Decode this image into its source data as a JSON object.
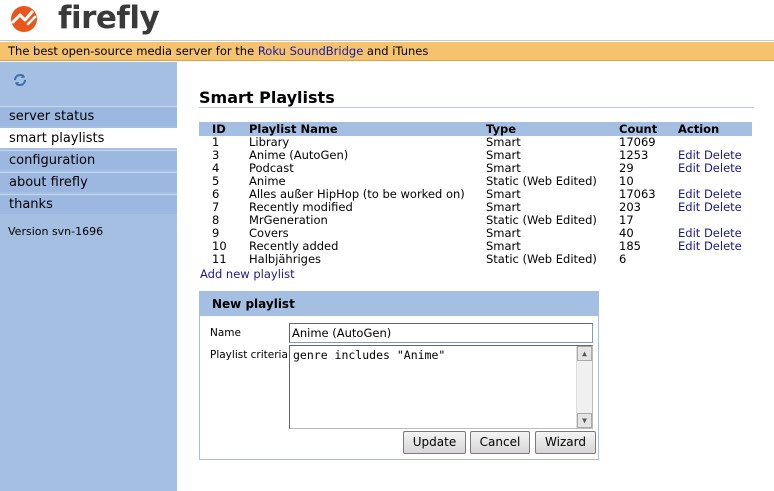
{
  "brand": {
    "name": "firefly",
    "accent": "#e8561c"
  },
  "tagline": {
    "prefix": "The best open-source media server for the ",
    "link": "Roku SoundBridge",
    "suffix": " and iTunes"
  },
  "sidebar": {
    "refresh_icon": "refresh-icon",
    "items": [
      {
        "label": "server status"
      },
      {
        "label": "smart playlists"
      },
      {
        "label": "configuration"
      },
      {
        "label": "about firefly"
      },
      {
        "label": "thanks"
      }
    ],
    "version": "Version svn-1696"
  },
  "main": {
    "title": "Smart Playlists",
    "columns": [
      "ID",
      "Playlist Name",
      "Type",
      "Count",
      "Action"
    ],
    "rows": [
      {
        "id": "1",
        "name": "Library",
        "type": "Smart",
        "count": "17069",
        "edit": "",
        "delete": ""
      },
      {
        "id": "3",
        "name": "Anime (AutoGen)",
        "type": "Smart",
        "count": "1253",
        "edit": "Edit",
        "delete": "Delete"
      },
      {
        "id": "4",
        "name": "Podcast",
        "type": "Smart",
        "count": "29",
        "edit": "Edit",
        "delete": "Delete"
      },
      {
        "id": "5",
        "name": "Anime",
        "type": "Static (Web Edited)",
        "count": "10",
        "edit": "",
        "delete": ""
      },
      {
        "id": "6",
        "name": "Alles außer HipHop (to be worked on)",
        "type": "Smart",
        "count": "17063",
        "edit": "Edit",
        "delete": "Delete"
      },
      {
        "id": "7",
        "name": "Recently modified",
        "type": "Smart",
        "count": "203",
        "edit": "Edit",
        "delete": "Delete"
      },
      {
        "id": "8",
        "name": "MrGeneration",
        "type": "Static (Web Edited)",
        "count": "17",
        "edit": "",
        "delete": ""
      },
      {
        "id": "9",
        "name": "Covers",
        "type": "Smart",
        "count": "40",
        "edit": "Edit",
        "delete": "Delete"
      },
      {
        "id": "10",
        "name": "Recently added",
        "type": "Smart",
        "count": "185",
        "edit": "Edit",
        "delete": "Delete"
      },
      {
        "id": "11",
        "name": "Halbjähriges",
        "type": "Static (Web Edited)",
        "count": "6",
        "edit": "",
        "delete": ""
      }
    ],
    "add_link": "Add new playlist"
  },
  "panel": {
    "title": "New playlist",
    "name_label": "Name",
    "name_value": "Anime (AutoGen)",
    "criteria_label": "Playlist criteria",
    "criteria_value": "genre includes \"Anime\"",
    "buttons": {
      "update": "Update",
      "cancel": "Cancel",
      "wizard": "Wizard"
    }
  }
}
